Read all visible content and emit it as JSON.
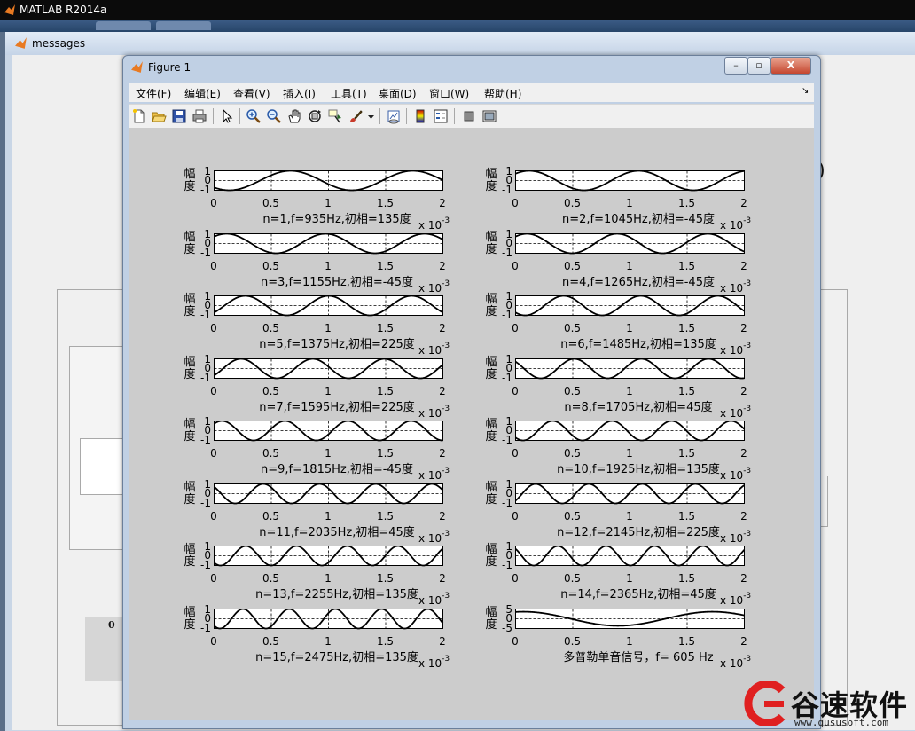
{
  "main_window": {
    "title": "MATLAB R2014a"
  },
  "messages_window": {
    "title": "messages",
    "partial_text": ")",
    "partial_label": "0"
  },
  "figure": {
    "title": "Figure 1",
    "window_buttons": {
      "minimize": "–",
      "maximize": "▫",
      "close": "X"
    },
    "menus": [
      "文件(F)",
      "编辑(E)",
      "查看(V)",
      "插入(I)",
      "工具(T)",
      "桌面(D)",
      "窗口(W)",
      "帮助(H)"
    ],
    "menu_arrow": "↘",
    "toolbar": [
      "new-figure-icon",
      "open-file-icon",
      "save-icon",
      "print-icon",
      "pointer-icon",
      "zoom-in-icon",
      "zoom-out-icon",
      "pan-hand-icon",
      "rotate-3d-icon",
      "data-cursor-icon",
      "brush-icon",
      "brush-dropdown-icon",
      "link-plot-icon",
      "colorbar-icon",
      "legend-icon",
      "hide-plot-tools-icon",
      "show-plot-tools-icon"
    ]
  },
  "chart_data": [
    {
      "type": "line",
      "caption": "n=1,f=935Hz,初相=135度",
      "ylabel": "幅度",
      "yticks": [
        "1",
        "0",
        "-1"
      ],
      "xticks": [
        "0",
        "0.5",
        "1",
        "1.5",
        "2"
      ],
      "x_multiplier": "x 10",
      "x_exponent": "-3",
      "xlim": [
        0,
        0.002
      ],
      "ylim": [
        -1,
        1
      ],
      "grid": true,
      "freq_hz": 935,
      "phase_deg": 135,
      "amplitude": 1
    },
    {
      "type": "line",
      "caption": "n=2,f=1045Hz,初相=-45度",
      "ylabel": "幅度",
      "yticks": [
        "1",
        "0",
        "-1"
      ],
      "xticks": [
        "0",
        "0.5",
        "1",
        "1.5",
        "2"
      ],
      "x_multiplier": "x 10",
      "x_exponent": "-3",
      "xlim": [
        0,
        0.002
      ],
      "ylim": [
        -1,
        1
      ],
      "grid": true,
      "freq_hz": 1045,
      "phase_deg": -45,
      "amplitude": 1
    },
    {
      "type": "line",
      "caption": "n=3,f=1155Hz,初相=-45度",
      "ylabel": "幅度",
      "yticks": [
        "1",
        "0",
        "-1"
      ],
      "xticks": [
        "0",
        "0.5",
        "1",
        "1.5",
        "2"
      ],
      "x_multiplier": "x 10",
      "x_exponent": "-3",
      "xlim": [
        0,
        0.002
      ],
      "ylim": [
        -1,
        1
      ],
      "grid": true,
      "freq_hz": 1155,
      "phase_deg": -45,
      "amplitude": 1
    },
    {
      "type": "line",
      "caption": "n=4,f=1265Hz,初相=-45度",
      "ylabel": "幅度",
      "yticks": [
        "1",
        "0",
        "-1"
      ],
      "xticks": [
        "0",
        "0.5",
        "1",
        "1.5",
        "2"
      ],
      "x_multiplier": "x 10",
      "x_exponent": "-3",
      "xlim": [
        0,
        0.002
      ],
      "ylim": [
        -1,
        1
      ],
      "grid": true,
      "freq_hz": 1265,
      "phase_deg": -45,
      "amplitude": 1
    },
    {
      "type": "line",
      "caption": "n=5,f=1375Hz,初相=225度",
      "ylabel": "幅度",
      "yticks": [
        "1",
        "0",
        "-1"
      ],
      "xticks": [
        "0",
        "0.5",
        "1",
        "1.5",
        "2"
      ],
      "x_multiplier": "x 10",
      "x_exponent": "-3",
      "xlim": [
        0,
        0.002
      ],
      "ylim": [
        -1,
        1
      ],
      "grid": true,
      "freq_hz": 1375,
      "phase_deg": 225,
      "amplitude": 1
    },
    {
      "type": "line",
      "caption": "n=6,f=1485Hz,初相=135度",
      "ylabel": "幅度",
      "yticks": [
        "1",
        "0",
        "-1"
      ],
      "xticks": [
        "0",
        "0.5",
        "1",
        "1.5",
        "2"
      ],
      "x_multiplier": "x 10",
      "x_exponent": "-3",
      "xlim": [
        0,
        0.002
      ],
      "ylim": [
        -1,
        1
      ],
      "grid": true,
      "freq_hz": 1485,
      "phase_deg": 135,
      "amplitude": 1
    },
    {
      "type": "line",
      "caption": "n=7,f=1595Hz,初相=225度",
      "ylabel": "幅度",
      "yticks": [
        "1",
        "0",
        "-1"
      ],
      "xticks": [
        "0",
        "0.5",
        "1",
        "1.5",
        "2"
      ],
      "x_multiplier": "x 10",
      "x_exponent": "-3",
      "xlim": [
        0,
        0.002
      ],
      "ylim": [
        -1,
        1
      ],
      "grid": true,
      "freq_hz": 1595,
      "phase_deg": 225,
      "amplitude": 1
    },
    {
      "type": "line",
      "caption": "n=8,f=1705Hz,初相=45度",
      "ylabel": "幅度",
      "yticks": [
        "1",
        "0",
        "-1"
      ],
      "xticks": [
        "0",
        "0.5",
        "1",
        "1.5",
        "2"
      ],
      "x_multiplier": "x 10",
      "x_exponent": "-3",
      "xlim": [
        0,
        0.002
      ],
      "ylim": [
        -1,
        1
      ],
      "grid": true,
      "freq_hz": 1705,
      "phase_deg": 45,
      "amplitude": 1
    },
    {
      "type": "line",
      "caption": "n=9,f=1815Hz,初相=-45度",
      "ylabel": "幅度",
      "yticks": [
        "1",
        "0",
        "-1"
      ],
      "xticks": [
        "0",
        "0.5",
        "1",
        "1.5",
        "2"
      ],
      "x_multiplier": "x 10",
      "x_exponent": "-3",
      "xlim": [
        0,
        0.002
      ],
      "ylim": [
        -1,
        1
      ],
      "grid": true,
      "freq_hz": 1815,
      "phase_deg": -45,
      "amplitude": 1
    },
    {
      "type": "line",
      "caption": "n=10,f=1925Hz,初相=135度",
      "ylabel": "幅度",
      "yticks": [
        "1",
        "0",
        "-1"
      ],
      "xticks": [
        "0",
        "0.5",
        "1",
        "1.5",
        "2"
      ],
      "x_multiplier": "x 10",
      "x_exponent": "-3",
      "xlim": [
        0,
        0.002
      ],
      "ylim": [
        -1,
        1
      ],
      "grid": true,
      "freq_hz": 1925,
      "phase_deg": 135,
      "amplitude": 1
    },
    {
      "type": "line",
      "caption": "n=11,f=2035Hz,初相=45度",
      "ylabel": "幅度",
      "yticks": [
        "1",
        "0",
        "-1"
      ],
      "xticks": [
        "0",
        "0.5",
        "1",
        "1.5",
        "2"
      ],
      "x_multiplier": "x 10",
      "x_exponent": "-3",
      "xlim": [
        0,
        0.002
      ],
      "ylim": [
        -1,
        1
      ],
      "grid": true,
      "freq_hz": 2035,
      "phase_deg": 45,
      "amplitude": 1
    },
    {
      "type": "line",
      "caption": "n=12,f=2145Hz,初相=225度",
      "ylabel": "幅度",
      "yticks": [
        "1",
        "0",
        "-1"
      ],
      "xticks": [
        "0",
        "0.5",
        "1",
        "1.5",
        "2"
      ],
      "x_multiplier": "x 10",
      "x_exponent": "-3",
      "xlim": [
        0,
        0.002
      ],
      "ylim": [
        -1,
        1
      ],
      "grid": true,
      "freq_hz": 2145,
      "phase_deg": 225,
      "amplitude": 1
    },
    {
      "type": "line",
      "caption": "n=13,f=2255Hz,初相=135度",
      "ylabel": "幅度",
      "yticks": [
        "1",
        "0",
        "-1"
      ],
      "xticks": [
        "0",
        "0.5",
        "1",
        "1.5",
        "2"
      ],
      "x_multiplier": "x 10",
      "x_exponent": "-3",
      "xlim": [
        0,
        0.002
      ],
      "ylim": [
        -1,
        1
      ],
      "grid": true,
      "freq_hz": 2255,
      "phase_deg": 135,
      "amplitude": 1
    },
    {
      "type": "line",
      "caption": "n=14,f=2365Hz,初相=45度",
      "ylabel": "幅度",
      "yticks": [
        "1",
        "0",
        "-1"
      ],
      "xticks": [
        "0",
        "0.5",
        "1",
        "1.5",
        "2"
      ],
      "x_multiplier": "x 10",
      "x_exponent": "-3",
      "xlim": [
        0,
        0.002
      ],
      "ylim": [
        -1,
        1
      ],
      "grid": true,
      "freq_hz": 2365,
      "phase_deg": 45,
      "amplitude": 1
    },
    {
      "type": "line",
      "caption": "n=15,f=2475Hz,初相=135度",
      "ylabel": "幅度",
      "yticks": [
        "1",
        "0",
        "-1"
      ],
      "xticks": [
        "0",
        "0.5",
        "1",
        "1.5",
        "2"
      ],
      "x_multiplier": "x 10",
      "x_exponent": "-3",
      "xlim": [
        0,
        0.002
      ],
      "ylim": [
        -1,
        1
      ],
      "grid": true,
      "freq_hz": 2475,
      "phase_deg": 135,
      "amplitude": 1
    },
    {
      "type": "line",
      "caption": "多普勒单音信号，f= 605 Hz",
      "ylabel": "幅度",
      "yticks": [
        "5",
        "0",
        "-5"
      ],
      "xticks": [
        "0",
        "0.5",
        "1",
        "1.5",
        "2"
      ],
      "x_multiplier": "x 10",
      "x_exponent": "-3",
      "xlim": [
        0,
        0.002
      ],
      "ylim": [
        -5,
        5
      ],
      "grid": true,
      "freq_hz": 605,
      "phase_deg": -15,
      "amplitude": 3.6
    }
  ],
  "watermark": {
    "name": "谷速软件",
    "url": "www.gususoft.com"
  }
}
